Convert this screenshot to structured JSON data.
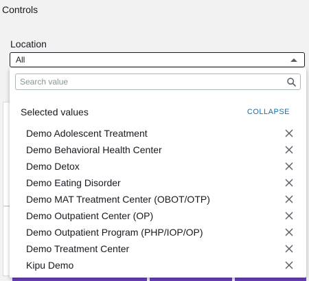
{
  "panel": {
    "title": "Controls"
  },
  "location": {
    "label": "Location",
    "selected_value": "All"
  },
  "dropdown": {
    "search_placeholder": "Search value",
    "selected_title": "Selected values",
    "collapse_label": "COLLAPSE",
    "items": [
      {
        "label": "Demo Adolescent Treatment"
      },
      {
        "label": "Demo Behavioral Health Center"
      },
      {
        "label": "Demo Detox"
      },
      {
        "label": "Demo Eating Disorder"
      },
      {
        "label": "Demo MAT Treatment Center (OBOT/OTP)"
      },
      {
        "label": "Demo Outpatient Center (OP)"
      },
      {
        "label": "Demo Outpatient Program (PHP/IOP/OP)"
      },
      {
        "label": "Demo Treatment Center"
      },
      {
        "label": "Kipu Demo"
      }
    ]
  },
  "icons": {
    "search": "search-icon",
    "remove": "close-icon",
    "caret": "caret-up-icon"
  },
  "colors": {
    "accent": "#0073bb",
    "background": "#f2f2f2",
    "purple_button": "#6b3fbf"
  }
}
